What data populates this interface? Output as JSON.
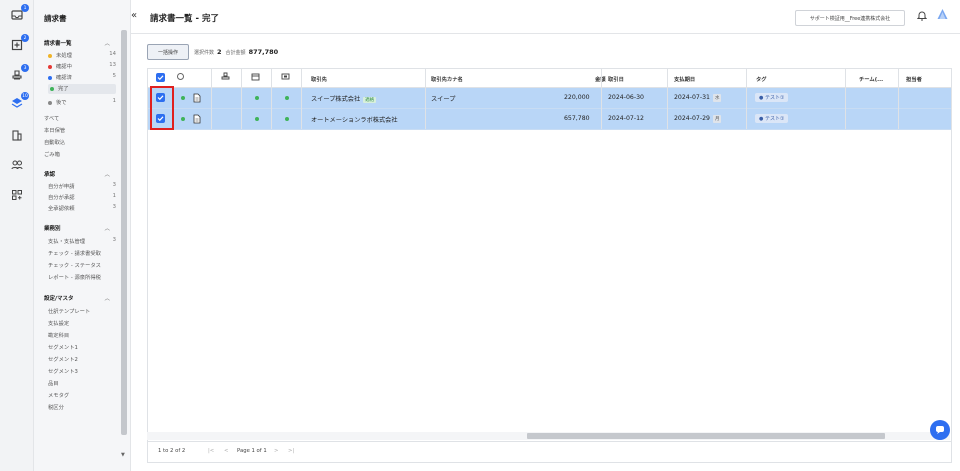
{
  "rail": {
    "badges": [
      "1",
      "2",
      "3",
      "2",
      "10"
    ]
  },
  "sidebar": {
    "title": "請求書",
    "section_invoices": "請求書一覧",
    "statuses": [
      {
        "label": "未処理",
        "count": "14",
        "color": "#f0b429"
      },
      {
        "label": "確認中",
        "count": "13",
        "color": "#e53935"
      },
      {
        "label": "確認済",
        "count": "5",
        "color": "#2d6ef0"
      },
      {
        "label": "完了",
        "count": "",
        "color": "#3fb35a"
      },
      {
        "label": "後で",
        "count": "1",
        "color": "#888888"
      }
    ],
    "links": [
      "すべて",
      "本日保管",
      "自動取込",
      "ごみ箱"
    ],
    "section_approval": "承認",
    "approval_items": [
      {
        "label": "自分が申請",
        "count": "3"
      },
      {
        "label": "自分が承認",
        "count": "1"
      },
      {
        "label": "全承認依頼",
        "count": "3"
      }
    ],
    "section_business": "業務別",
    "business_items": [
      {
        "label": "支払・支払管理",
        "count": "3"
      },
      {
        "label": "チェック - 請求書受取",
        "count": ""
      },
      {
        "label": "チェック - ステータス",
        "count": ""
      },
      {
        "label": "レポート - 源泉所得税",
        "count": ""
      }
    ],
    "section_settings": "設定/マスタ",
    "settings_items": [
      "仕訳テンプレート",
      "支払設定",
      "勘定科目",
      "セグメント1",
      "セグメント2",
      "セグメント3",
      "品目",
      "メモタグ",
      "税区分"
    ]
  },
  "header": {
    "title": "請求書一覧 - 完了",
    "support_button": "サポート検証用__Free連携株式会社"
  },
  "toolbar": {
    "bulk_button": "一括操作",
    "selected_label": "選択件数",
    "selected_count": "2",
    "total_label": "合計金額",
    "total_amount": "877,780"
  },
  "table": {
    "headers": {
      "partner": "取引先",
      "partner_kana": "取引先カナ名",
      "amount": "金額",
      "trade_date": "取引日",
      "due_date": "支払期日",
      "tag": "タグ",
      "team": "チーム(...",
      "owner": "担当者"
    },
    "rows": [
      {
        "partner": "スイープ株式会社",
        "badge": "適格",
        "partner_kana": "スイープ",
        "amount": "220,000",
        "trade_date": "2024-06-30",
        "due_date": "2024-07-31",
        "weekday": "水",
        "tag": "テスト①"
      },
      {
        "partner": "オートメーションラボ株式会社",
        "badge": "",
        "partner_kana": "",
        "amount": "657,780",
        "trade_date": "2024-07-12",
        "due_date": "2024-07-29",
        "weekday": "月",
        "tag": "テスト①"
      }
    ]
  },
  "pager": {
    "range": "1 to 2 of 2",
    "page": "Page 1 of 1"
  }
}
